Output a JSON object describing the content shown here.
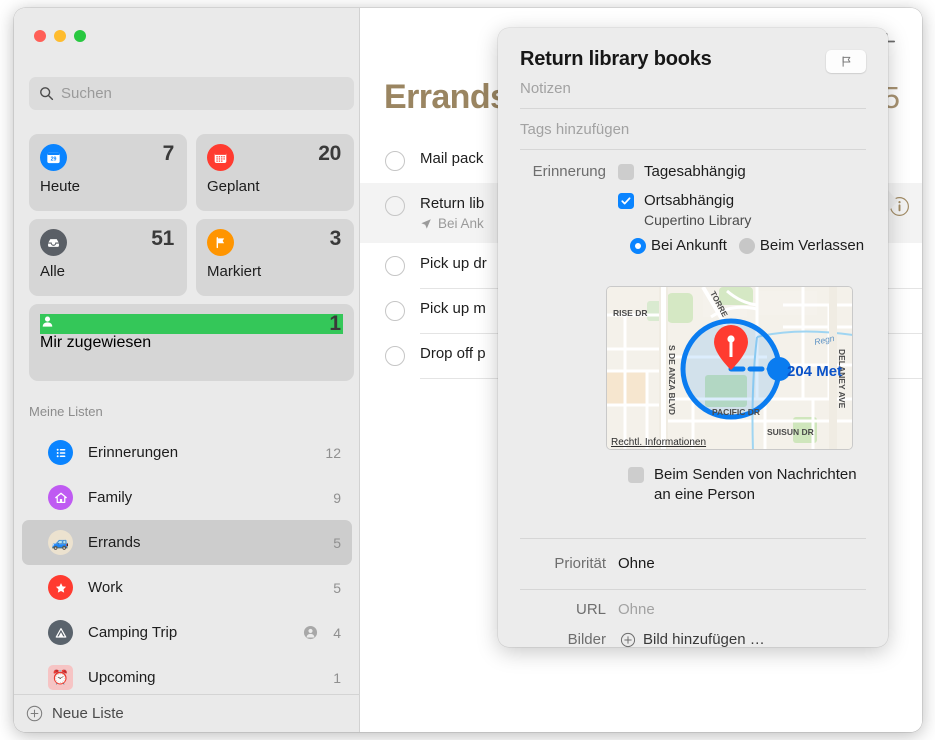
{
  "window": {
    "traffic_lights": [
      "close",
      "minimize",
      "zoom"
    ]
  },
  "sidebar": {
    "search": {
      "placeholder": "Suchen",
      "value": "",
      "icon": "search-icon"
    },
    "smart_cards": [
      {
        "label": "Heute",
        "count": "7",
        "icon": "calendar-day-icon",
        "color": "#0a84ff",
        "glyph": "29"
      },
      {
        "label": "Geplant",
        "count": "20",
        "icon": "calendar-icon",
        "color": "#ff3b30",
        "glyph": ""
      },
      {
        "label": "Alle",
        "count": "51",
        "icon": "inbox-tray-icon",
        "color": "#5a5f66",
        "glyph": ""
      },
      {
        "label": "Markiert",
        "count": "3",
        "icon": "flag-icon",
        "color": "#ff9500",
        "glyph": ""
      }
    ],
    "assigned_card": {
      "label": "Mir zugewiesen",
      "count": "1",
      "icon": "person-icon",
      "color": "#34c759"
    },
    "section_header": "Meine Listen",
    "lists": [
      {
        "label": "Erinnerungen",
        "count": "12",
        "icon": "list-bullet-icon",
        "color": "#0a84ff",
        "shared": false,
        "selected": false
      },
      {
        "label": "Family",
        "count": "9",
        "icon": "house-icon",
        "color": "#bf5af2",
        "shared": false,
        "selected": false
      },
      {
        "label": "Errands",
        "count": "5",
        "icon": "pickup-truck-icon",
        "color": "#ece2cf",
        "shared": false,
        "selected": true,
        "emoji": "🚙"
      },
      {
        "label": "Work",
        "count": "5",
        "icon": "star-icon",
        "color": "#ff3b30",
        "shared": false,
        "selected": false
      },
      {
        "label": "Camping Trip",
        "count": "4",
        "icon": "tent-icon",
        "color": "#5a636c",
        "shared": true,
        "selected": false
      },
      {
        "label": "Upcoming",
        "count": "1",
        "icon": "alarm-clock-icon",
        "color": "#f6c4c4",
        "shared": false,
        "selected": false,
        "emoji": "⏰"
      }
    ],
    "footer": {
      "label": "Neue Liste",
      "icon": "plus-circle-icon"
    }
  },
  "main": {
    "title": "Errands",
    "count": "5",
    "add_button_icon": "plus-icon",
    "info_button_icon": "info-circle-icon",
    "accent_color": "#9a8561",
    "reminders": [
      {
        "title": "Mail pack",
        "subtitle": "",
        "selected": false,
        "has_location": false
      },
      {
        "title": "Return lib",
        "subtitle": "Bei Ank",
        "selected": true,
        "has_location": true
      },
      {
        "title": "Pick up dr",
        "subtitle": "",
        "selected": false,
        "has_location": false
      },
      {
        "title": "Pick up m",
        "subtitle": "",
        "selected": false,
        "has_location": false
      },
      {
        "title": "Drop off p",
        "subtitle": "",
        "selected": false,
        "has_location": false
      }
    ]
  },
  "popover": {
    "title": "Return library books",
    "flag_button_icon": "flag-outline-icon",
    "notes_placeholder": "Notizen",
    "tags_placeholder": "Tags hinzufügen",
    "reminder_label": "Erinnerung",
    "date_checkbox": {
      "label": "Tagesabhängig",
      "checked": false
    },
    "location_checkbox": {
      "label": "Ortsabhängig",
      "checked": true
    },
    "location_value": "Cupertino Library",
    "radio_arrive": {
      "label": "Bei Ankunft",
      "selected": true
    },
    "radio_leave": {
      "label": "Beim Verlassen",
      "selected": false
    },
    "message_checkbox": {
      "label": "Beim Senden von Nachrichten an eine Person",
      "checked": false
    },
    "priority": {
      "label": "Priorität",
      "value": "Ohne"
    },
    "url": {
      "label": "URL",
      "value": "Ohne"
    },
    "images": {
      "label": "Bilder",
      "value": "Bild hinzufügen …",
      "icon": "plus-circle-icon"
    },
    "accent_color": "#0a84ff"
  },
  "map": {
    "radius_label": "204 Met",
    "legal_label": "Rechtl. Informationen",
    "pin_icon": "map-pin-icon",
    "streets": [
      "RISE DR",
      "S DE ANZA BLVD",
      "TORRE AVE",
      "PACIFIC DR",
      "SUISUN DR",
      "DELANEY AVE",
      "Regnart Creek"
    ],
    "geofence_color": "#0a7cf0"
  }
}
